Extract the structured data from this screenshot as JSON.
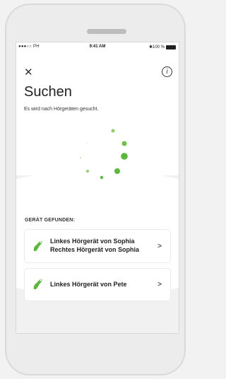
{
  "statusbar": {
    "carrier": "●●●○○ PH",
    "time": "9:41 AM",
    "battery_text": "✱100 %"
  },
  "header": {
    "close_icon": "close-icon",
    "info_icon": "info-icon",
    "title": "Suchen",
    "subtitle": "Es wird nach Hörgeräten gesucht."
  },
  "spinner": {
    "icon": "loading-spinner",
    "color": "#6cc24a"
  },
  "found": {
    "label": "GERÄT GEFUNDEN:",
    "devices": [
      {
        "line1": "Linkes Hörgerät von Sophia",
        "line2": "Rechtes Hörgerät von Sophia",
        "icon": "hearing-aid-icon"
      },
      {
        "line1": "Linkes Hörgerät von Pete",
        "icon": "hearing-aid-icon"
      }
    ],
    "chevron": ">"
  },
  "colors": {
    "accent": "#6cc24a",
    "background": "#f1f1f1"
  }
}
